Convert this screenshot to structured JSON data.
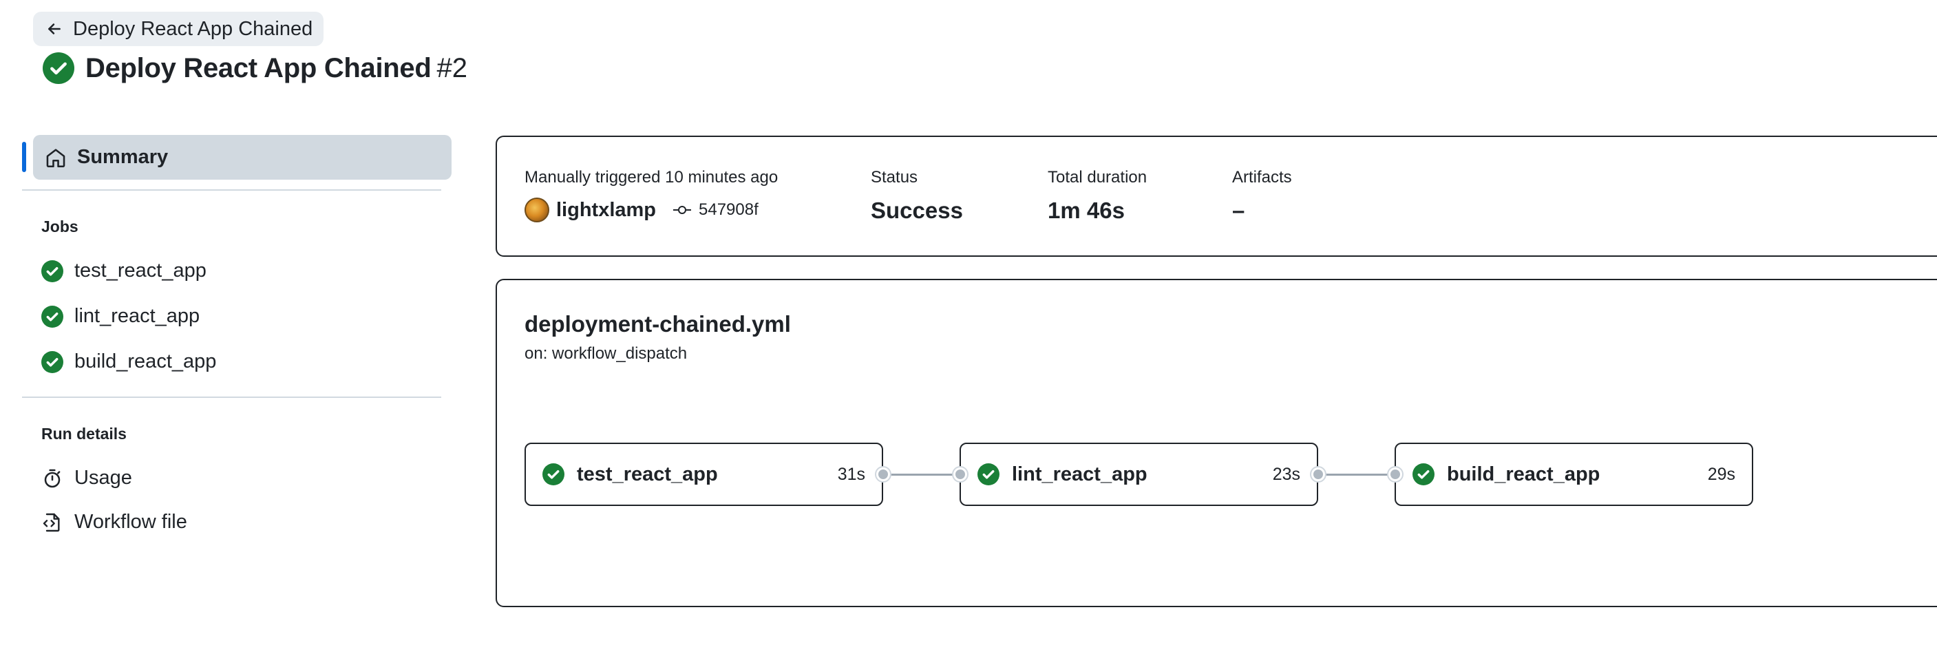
{
  "back_link": {
    "label": "Deploy React App Chained"
  },
  "header": {
    "title": "Deploy React App Chained",
    "run_number": "#2"
  },
  "sidebar": {
    "summary_label": "Summary",
    "jobs_heading": "Jobs",
    "jobs": [
      {
        "label": "test_react_app"
      },
      {
        "label": "lint_react_app"
      },
      {
        "label": "build_react_app"
      }
    ],
    "run_details_heading": "Run details",
    "run_details": [
      {
        "label": "Usage"
      },
      {
        "label": "Workflow file"
      }
    ]
  },
  "summary": {
    "trigger_text": "Manually triggered 10 minutes ago",
    "actor": "lightxlamp",
    "commit": "547908f",
    "status_label": "Status",
    "status_value": "Success",
    "duration_label": "Total duration",
    "duration_value": "1m 46s",
    "artifacts_label": "Artifacts",
    "artifacts_value": "–"
  },
  "workflow": {
    "file_name": "deployment-chained.yml",
    "trigger": "on: workflow_dispatch",
    "jobs": [
      {
        "name": "test_react_app",
        "duration": "31s"
      },
      {
        "name": "lint_react_app",
        "duration": "23s"
      },
      {
        "name": "build_react_app",
        "duration": "29s"
      }
    ]
  },
  "colors": {
    "success": "#1a7f37",
    "accent": "#0969da"
  }
}
